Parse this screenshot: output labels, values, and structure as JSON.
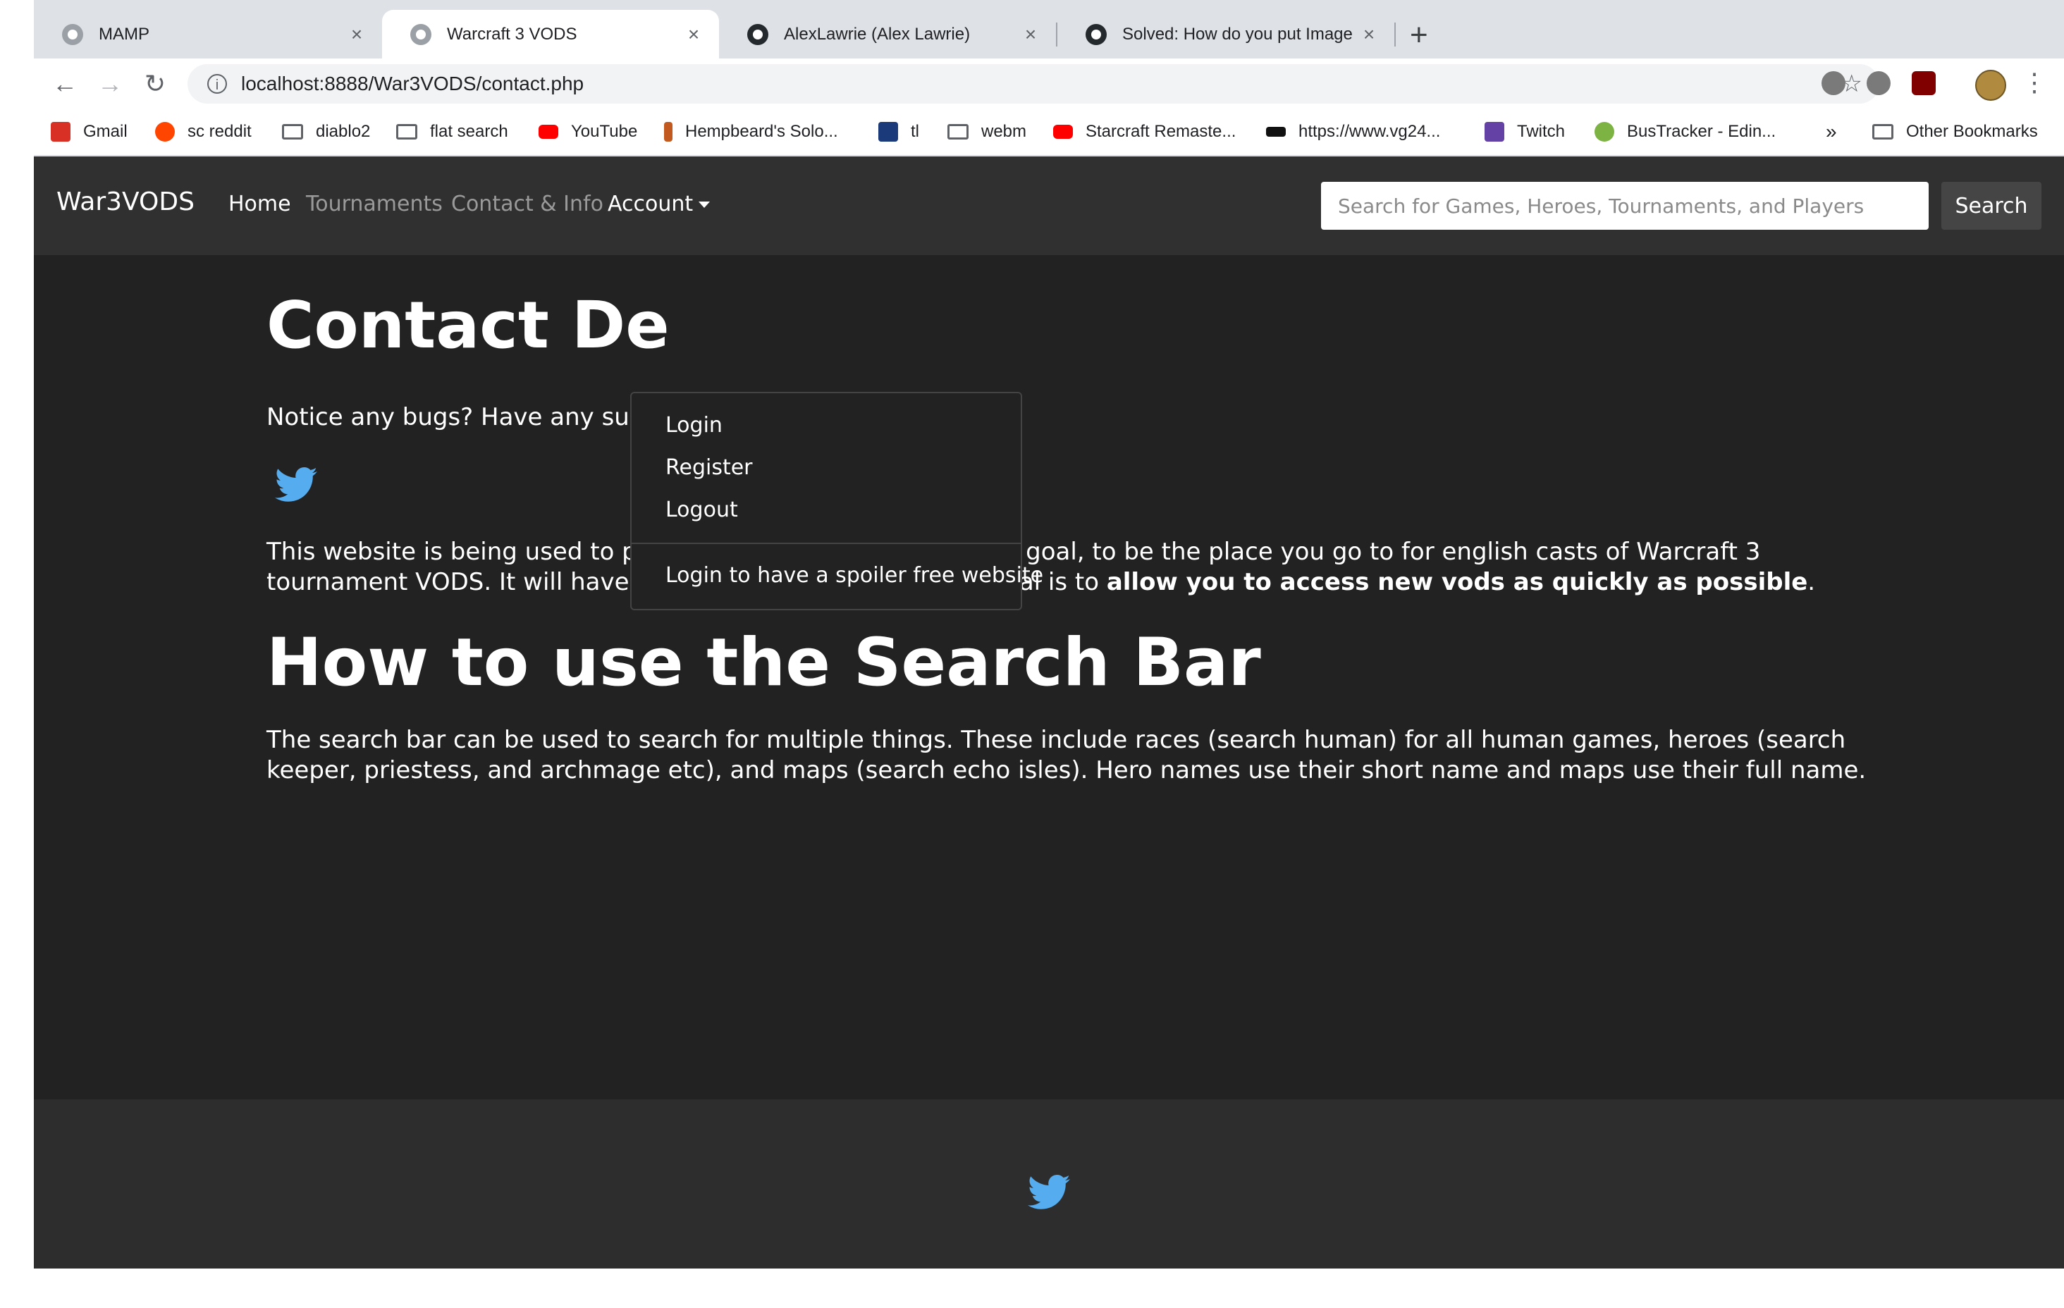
{
  "browser": {
    "tabs": [
      {
        "title": "MAMP",
        "active": false
      },
      {
        "title": "Warcraft 3 VODS",
        "active": true
      },
      {
        "title": "AlexLawrie (Alex Lawrie)",
        "active": false
      },
      {
        "title": "Solved: How do you put Image",
        "active": false
      }
    ],
    "new_tab_label": "+",
    "close_glyph": "×",
    "url": "localhost:8888/War3VODS/contact.php",
    "bookmarks": [
      {
        "label": "Gmail",
        "icon": "gmail-icon",
        "color": "#d93025"
      },
      {
        "label": "sc reddit",
        "icon": "reddit-icon",
        "color": "#ff4500"
      },
      {
        "label": "diablo2",
        "icon": "folder-icon",
        "color": "#5f6368"
      },
      {
        "label": "flat search",
        "icon": "folder-icon",
        "color": "#5f6368"
      },
      {
        "label": "YouTube",
        "icon": "youtube-icon",
        "color": "#ff0000"
      },
      {
        "label": "Hempbeard's Solo...",
        "icon": "hemp-icon",
        "color": "#c25a1f"
      },
      {
        "label": "tl",
        "icon": "tl-icon",
        "color": "#1a3a7a"
      },
      {
        "label": "webm",
        "icon": "folder-icon",
        "color": "#5f6368"
      },
      {
        "label": "Starcraft Remaste...",
        "icon": "youtube-icon",
        "color": "#ff0000"
      },
      {
        "label": "https://www.vg24...",
        "icon": "vg-icon",
        "color": "#111111"
      },
      {
        "label": "Twitch",
        "icon": "twitch-icon",
        "color": "#6441a5"
      },
      {
        "label": "BusTracker - Edin...",
        "icon": "bus-icon",
        "color": "#7cb342"
      }
    ],
    "overflow_label": "»",
    "other_bookmarks": "Other Bookmarks"
  },
  "site": {
    "brand": "War3VODS",
    "nav": [
      {
        "label": "Home",
        "active": true
      },
      {
        "label": "Tournaments",
        "active": false
      },
      {
        "label": "Contact & Info",
        "active": false
      },
      {
        "label": "Account",
        "active": true
      }
    ],
    "search_placeholder": "Search for Games, Heroes, Tournaments, and Players",
    "search_button": "Search",
    "account_menu": {
      "items": [
        "Login",
        "Register",
        "Logout"
      ],
      "extra": "Login to have a spoiler free website"
    }
  },
  "content": {
    "heading": "Contact De",
    "contact_text": "Notice any bugs? Have any su",
    "about_text_1": "This website is being used to practise my PHP skills. It has one goal, to be the place you go to for english casts of Warcraft 3 tournament VODS. It will have a simple design and its main goal is to ",
    "about_text_bold": "allow you to access new vods as quickly as possible",
    "about_text_end": ".",
    "search_heading": "How to use the Search Bar",
    "search_text": "The search bar can be used to search for multiple things. These include races (search human) for all human games, heroes (search keeper, priestess, and archmage etc), and maps (search echo isles). Hero names use their short name and maps use their full name."
  },
  "colors": {
    "page_bg": "#222222",
    "navbar_bg": "#303030",
    "twitter_blue": "#55acee"
  }
}
